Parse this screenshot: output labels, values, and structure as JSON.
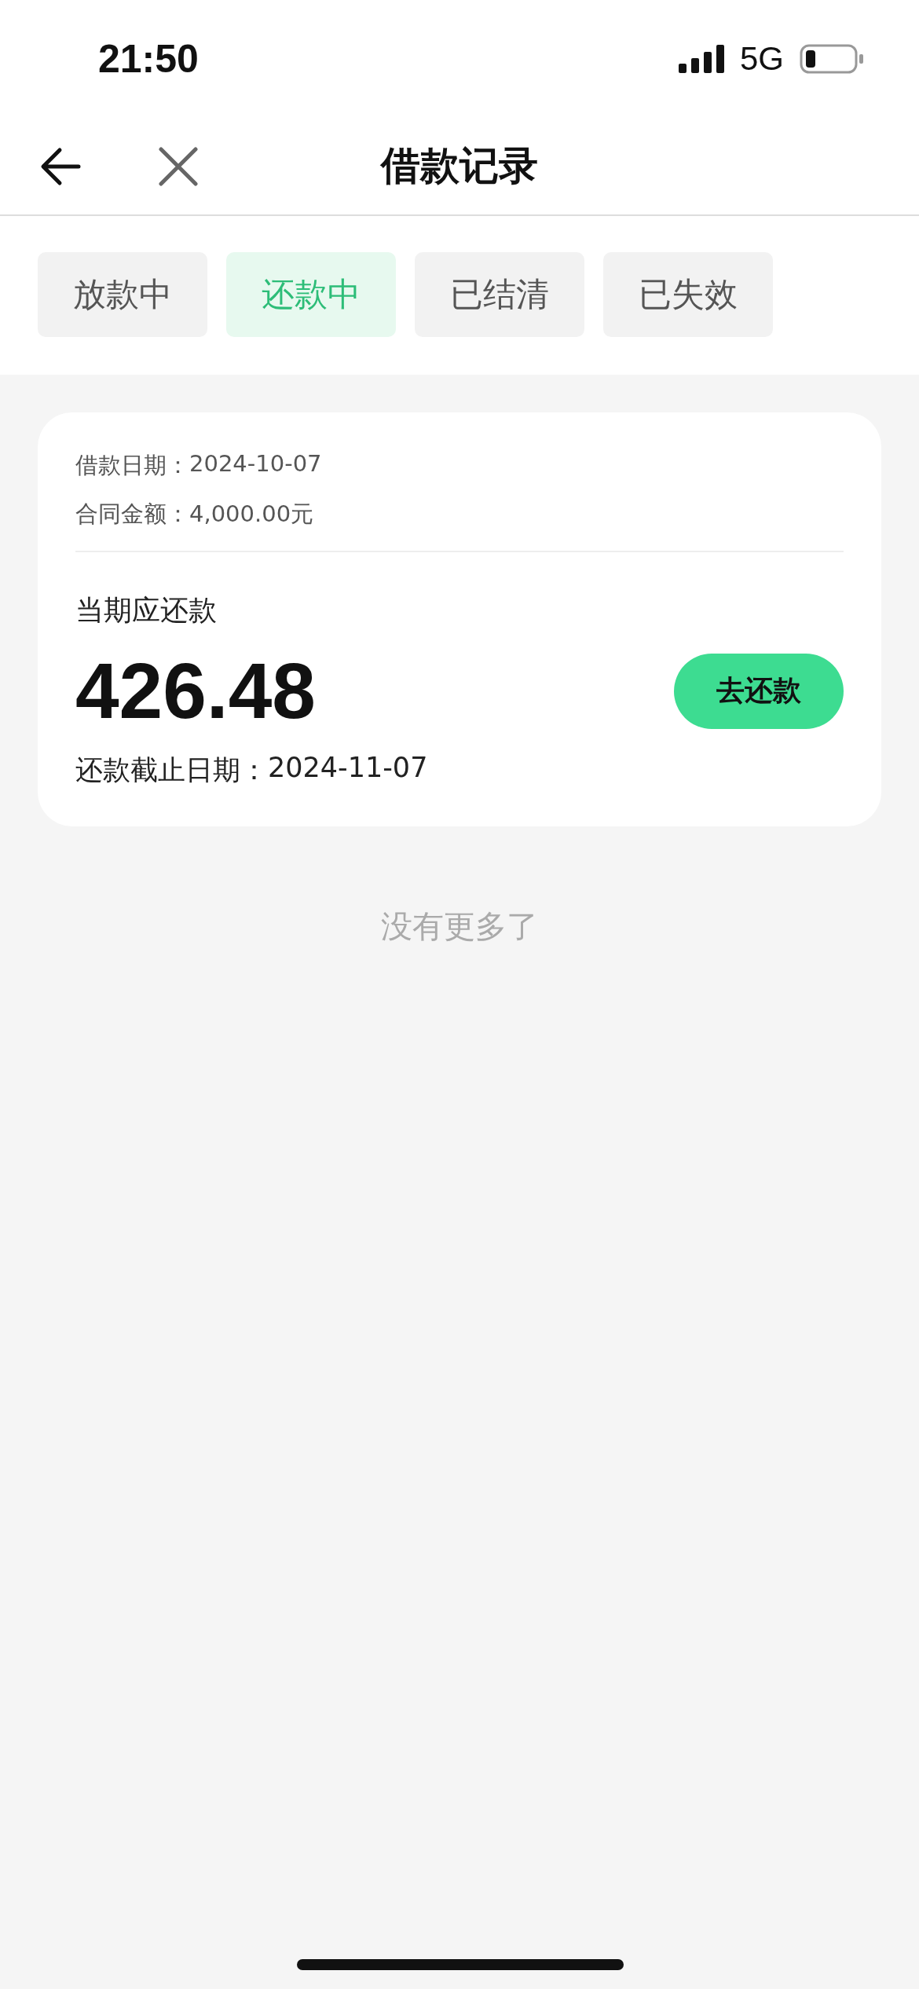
{
  "status_bar": {
    "time": "21:50",
    "network": "5G"
  },
  "nav": {
    "title": "借款记录"
  },
  "tabs": [
    {
      "label": "放款中",
      "selected": false
    },
    {
      "label": "还款中",
      "selected": true
    },
    {
      "label": "已结清",
      "selected": false
    },
    {
      "label": "已失效",
      "selected": false
    }
  ],
  "records": [
    {
      "loan_date_label": "借款日期：",
      "loan_date": "2024-10-07",
      "contract_label": "合同金额：",
      "contract_amount": "4,000.00元",
      "due_label": "当期应还款",
      "amount": "426.48",
      "button": "去还款",
      "deadline_label": "还款截止日期：",
      "deadline": "2024-11-07"
    }
  ],
  "footer": "没有更多了"
}
